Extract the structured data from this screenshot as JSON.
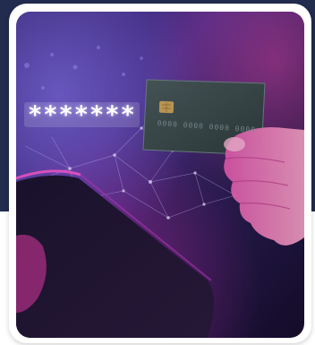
{
  "photo": {
    "password_mask": "*******",
    "card_number": "0000 0000 0000 0000",
    "colors": {
      "navy_band": "#212c4e",
      "glow_magenta": "#d63ab8",
      "glow_purple": "#5a3aa6",
      "card_body": "#3f4f50",
      "chip": "#c8a15a"
    }
  }
}
